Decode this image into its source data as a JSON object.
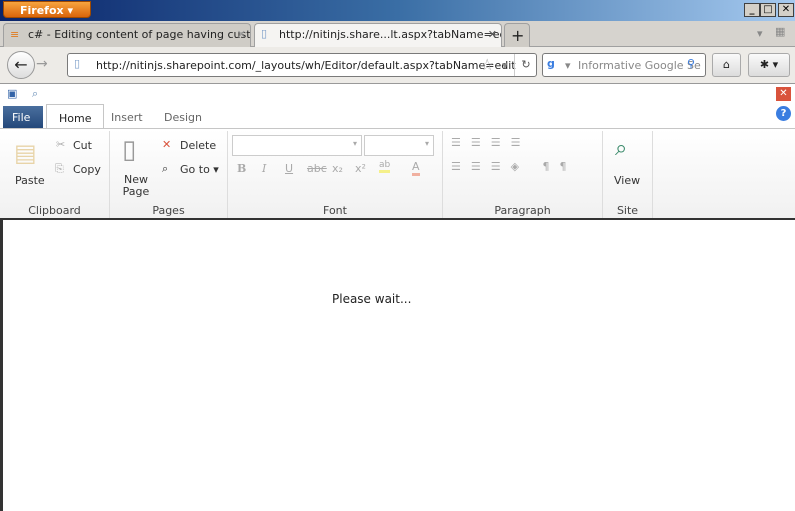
{
  "browser": {
    "menu_label": "Firefox",
    "window_buttons": [
      "_",
      "□",
      "✕"
    ],
    "tabs": [
      {
        "label": "c# - Editing content of page having cust...",
        "active": false
      },
      {
        "label": "http://nitinjs.share...lt.aspx?tabName=edit",
        "active": true
      }
    ],
    "new_tab": "+",
    "url": "http://nitinjs.sharepoint.com/_layouts/wh/Editor/default.aspx?tabName=edit",
    "search_placeholder": "Informative Google Se"
  },
  "ribbon": {
    "tabs": [
      "File",
      "Home",
      "Insert",
      "Design"
    ],
    "active_tab": "Home",
    "clipboard": {
      "label": "Clipboard",
      "paste": "Paste",
      "cut": "Cut",
      "copy": "Copy"
    },
    "pages": {
      "label": "Pages",
      "new_page": "New Page",
      "delete": "Delete",
      "goto": "Go to"
    },
    "font": {
      "label": "Font",
      "buttons": [
        "B",
        "I",
        "U",
        "abc",
        "x₂",
        "x²",
        "ab",
        "A"
      ]
    },
    "paragraph": {
      "label": "Paragraph"
    },
    "site": {
      "label": "Site",
      "view": "View"
    }
  },
  "content": {
    "message": "Please wait..."
  }
}
